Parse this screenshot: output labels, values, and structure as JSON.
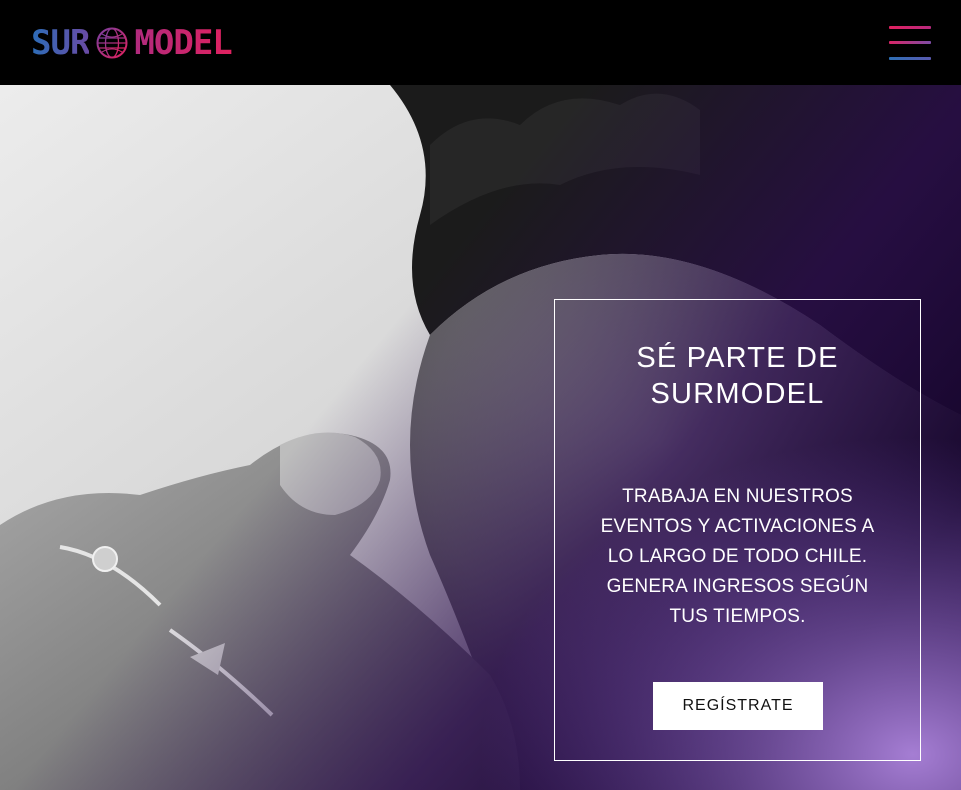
{
  "header": {
    "logo": {
      "left_text": "SUR",
      "right_text": "MODEL",
      "icon": "globe-icon"
    },
    "menu_icon": "hamburger-menu-icon"
  },
  "hero": {
    "image_description_icon": "photo-background",
    "promo": {
      "title": "SÉ PARTE DE SURMODEL",
      "text": "TRABAJA EN NUESTROS EVENTOS Y ACTIVACIONES A LO LARGO DE TODO CHILE. GENERA INGRESOS SEGÚN TUS TIEMPOS.",
      "button_label": "REGÍSTRATE"
    }
  },
  "colors": {
    "header_bg": "#000000",
    "logo_blue": "#2c6db7",
    "logo_magenta": "#e0215f",
    "purple_overlay": "#2a0f52",
    "button_bg": "#ffffff"
  }
}
